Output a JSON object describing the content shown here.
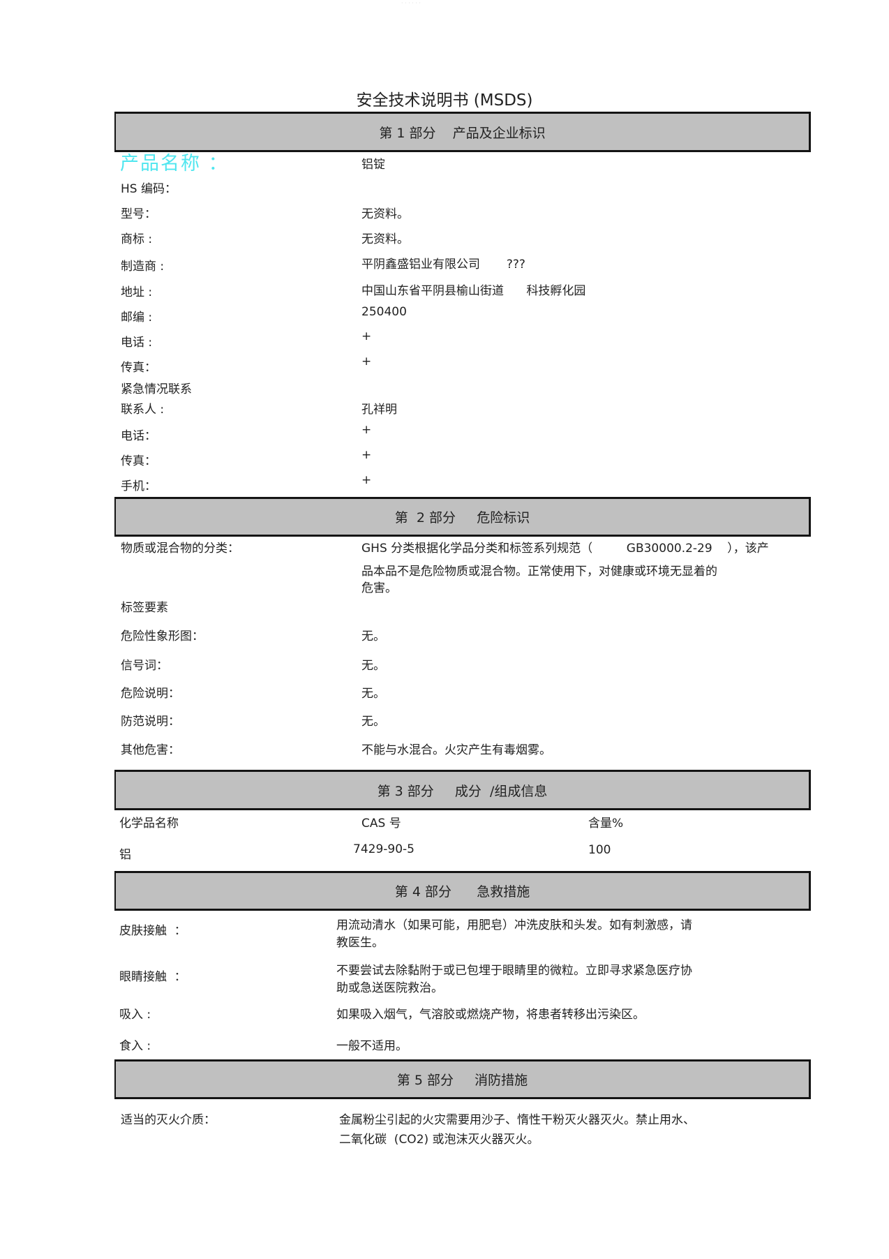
{
  "header_marks": "· · · ·   · ·",
  "title": "安全技术说明书 (MSDS)",
  "section1": {
    "heading": "第 1 部分    产品及企业标识",
    "rows": [
      {
        "label": "产品名称    ：",
        "value": "铝锭"
      },
      {
        "label": "HS 编码：",
        "value": ""
      },
      {
        "label": "型号：",
        "value": "无资料。"
      },
      {
        "label": "商标 :",
        "value": "无资料。"
      },
      {
        "label": "制造商 :",
        "value": "平阴鑫盛铝业有限公司       ???"
      },
      {
        "label": "地址 :",
        "value": "中国山东省平阴县榆山街道      科技孵化园"
      },
      {
        "label": "邮编 :",
        "value": "250400"
      },
      {
        "label": "电话 :",
        "value": "+"
      },
      {
        "label": "传真：",
        "value": "+"
      },
      {
        "label": "紧急情况联系",
        "value": ""
      },
      {
        "label": "联系人 :",
        "value": "孔祥明"
      },
      {
        "label": "电话：",
        "value": "+"
      },
      {
        "label": "传真：",
        "value": "+"
      },
      {
        "label": "手机：",
        "value": "+"
      }
    ]
  },
  "section2": {
    "heading": "第  2 部分     危险标识",
    "classification_label": "物质或混合物的分类：",
    "classification_line1": "GHS 分类根据化学品分类和标签系列规范（         GB30000.2-29    ），该产",
    "classification_line2": "品本品不是危险物质或混合物。正常使用下，对健康或环境无显着的",
    "classification_line3": "危害。",
    "label_elements": "标签要素",
    "rows": [
      {
        "label": "危险性象形图：",
        "value": "无。"
      },
      {
        "label": "信号词：",
        "value": "无。"
      },
      {
        "label": "危险说明：",
        "value": "无。"
      },
      {
        "label": "防范说明：",
        "value": "无。"
      },
      {
        "label": "其他危害：",
        "value": "不能与水混合。火灾产生有毒烟雾。"
      }
    ]
  },
  "section3": {
    "heading": "第 3 部分     成分  /组成信息",
    "columns": [
      "化学品名称",
      "CAS 号",
      "含量%"
    ],
    "rows": [
      {
        "name": "铝",
        "cas": "7429-90-5",
        "content": "100"
      }
    ]
  },
  "section4": {
    "heading": "第 4 部分      急救措施",
    "rows": [
      {
        "label": "皮肤接触  ：",
        "line1": "用流动清水（如果可能，用肥皂）冲洗皮肤和头发。如有刺激感，请",
        "line2": "教医生。"
      },
      {
        "label": "眼睛接触  ：",
        "line1": "不要尝试去除黏附于或已包埋于眼睛里的微粒。立即寻求紧急医疗协",
        "line2": "助或急送医院救治。"
      },
      {
        "label": "吸入 :",
        "line1": "如果吸入烟气，气溶胶或燃烧产物，将患者转移出污染区。",
        "line2": ""
      },
      {
        "label": "食入 :",
        "line1": "一般不适用。",
        "line2": ""
      }
    ]
  },
  "section5": {
    "heading": "第 5 部分     消防措施",
    "rows": [
      {
        "label": "适当的灭火介质：",
        "line1": "金属粉尘引起的火灾需要用沙子、惰性干粉灭火器灭火。禁止用水、",
        "line2": "二氧化碳  (CO2) 或泡沫灭火器灭火。"
      }
    ]
  }
}
